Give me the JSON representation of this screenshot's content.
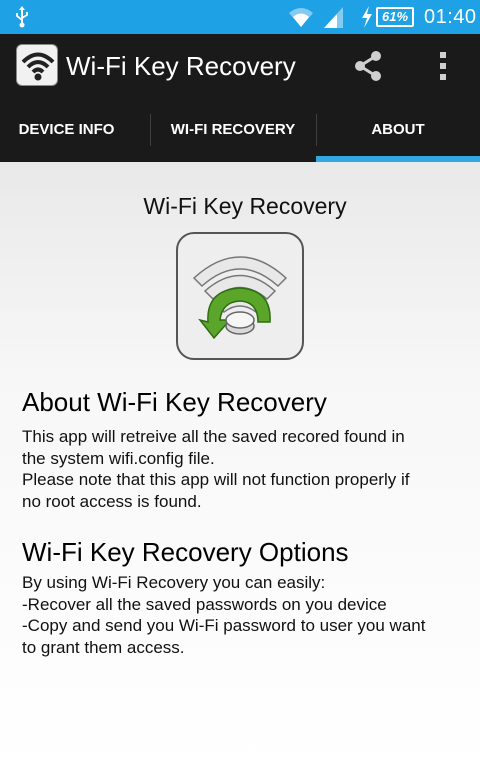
{
  "status_bar": {
    "battery_label": "61%",
    "time": "01:40",
    "icons": [
      "usb-icon",
      "wifi-signal-icon",
      "cell-signal-icon",
      "charging-bolt-icon",
      "battery-icon"
    ],
    "bg_color": "#1fa1e6"
  },
  "action_bar": {
    "title": "Wi-Fi Key Recovery",
    "icons": [
      "app-icon",
      "share-icon",
      "overflow-menu-icon"
    ]
  },
  "tabs": [
    {
      "label": "DEVICE INFO",
      "selected": false
    },
    {
      "label": "WI-FI RECOVERY",
      "selected": false
    },
    {
      "label": "ABOUT",
      "selected": true
    }
  ],
  "about": {
    "heading": "Wi-Fi Key Recovery",
    "section1_title": "About Wi-Fi Key Recovery",
    "section1_lines": [
      "This app will retreive all the saved recored found in",
      "the system wifi.config file.",
      "Please note that this app will not function properly if",
      "no root access is found."
    ],
    "section2_title": "Wi-Fi Key Recovery Options",
    "section2_lines": [
      "By using Wi-Fi Recovery you can easily:",
      "-Recover all the saved passwords on you device",
      "-Copy and send you Wi-Fi password to user you want",
      "to grant them access."
    ]
  },
  "colors": {
    "accent": "#31a8e0",
    "action_bar": "#1a1a1a",
    "logo_arrow": "#5aa52a"
  }
}
